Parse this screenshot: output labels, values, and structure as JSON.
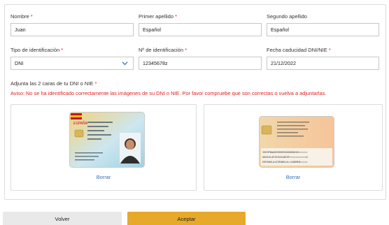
{
  "form": {
    "nombre": {
      "label": "Nombre",
      "value": "Juan"
    },
    "primer_apellido": {
      "label": "Primer apellido",
      "value": "Español"
    },
    "segundo_apellido": {
      "label": "Segundo apellido",
      "value": "Español"
    },
    "tipo_identificacion": {
      "label": "Tipo de identificación",
      "value": "DNI"
    },
    "numero_identificacion": {
      "label": "Nº de identificación",
      "value": "12345678z"
    },
    "fecha_caducidad": {
      "label": "Fecha caducidad DNI/NIE",
      "value": "21/12/2022"
    },
    "required_mark": "*"
  },
  "attach": {
    "title": "Adjunta las 2 caras de tu DNI o NIE",
    "warning": "Aviso: No se ha identificado correctamente las imágenes de su DNI o NIE. Por favor compruebe que son correctas o vuelva a adjuntarlas.",
    "front_delete": "Borrar",
    "back_delete": "Borrar",
    "front_card_country": "ESPAÑA",
    "back_card_mrz": [
      "IDESPBAA000000599999999H<<<<<<",
      "8001014F2501018ESP<<<<<<<<<<<9",
      "ESPANOLA<ESPANOLA<<CARMEN<<<<<"
    ]
  },
  "buttons": {
    "back": "Volver",
    "accept": "Aceptar"
  },
  "colors": {
    "required": "#e02020",
    "link": "#3a6fb7",
    "accept_bg": "#e7a92a",
    "back_bg": "#e9e9e9"
  },
  "icons": {
    "select_arrow": "chevron-down-icon"
  }
}
